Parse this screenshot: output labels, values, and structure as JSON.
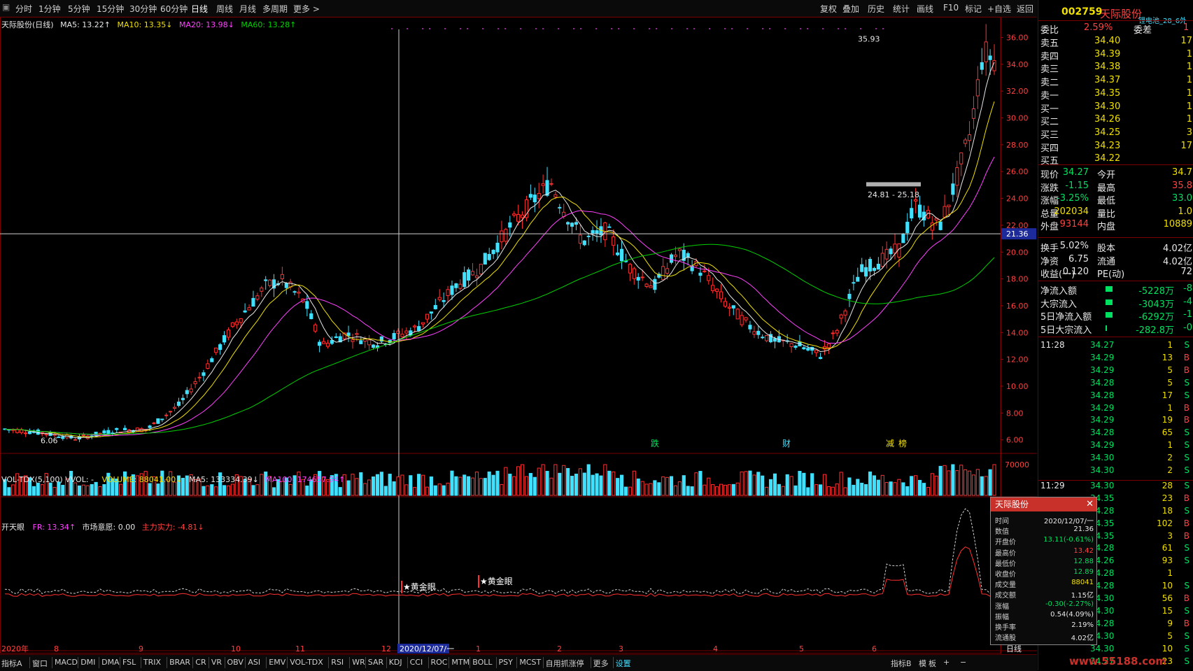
{
  "toolbar": {
    "left_items": [
      "分时",
      "1分钟",
      "5分钟",
      "15分钟",
      "30分钟",
      "60分钟",
      "日线",
      "周线",
      "月线",
      "多周期",
      "更多 >"
    ],
    "active": "日线",
    "right_items": [
      "复权",
      "叠加",
      "历史",
      "统计",
      "画线",
      "F10",
      "标记",
      "+自选",
      "返回"
    ]
  },
  "main_chart": {
    "title": "天际股份(日线)",
    "ma5": "MA5: 13.22↑",
    "ma10": "MA10: 13.35↓",
    "ma20": "MA20: 13.98↓",
    "ma60": "MA60: 13.28↑",
    "price_axis": [
      "36.00",
      "34.00",
      "32.00",
      "30.00",
      "28.00",
      "26.00",
      "24.00",
      "22.00",
      "20.00",
      "18.00",
      "16.00",
      "14.00",
      "12.00",
      "10.00",
      "8.00",
      "6.00"
    ],
    "crosshair_price": "21.36",
    "high_label": "35.93",
    "low_label": "6.06",
    "range_label": "24.81 - 25.18",
    "event_labels": [
      "跌",
      "财",
      "减",
      "榜"
    ]
  },
  "volume_chart": {
    "title": "VOL-TDX(5,100) VVOL: -",
    "volume": "VOLUME: 88041.00↓",
    "ma5": "MA5: 133334.39↓",
    "ma100": "MA100: 174657.94↑",
    "axis_top": "70000"
  },
  "ktj_chart": {
    "title": "开天眼",
    "fr": "FR: 13.34↑",
    "yy": "市场意愿: 0.00",
    "zl": "主力实力: -4.81↓",
    "signals": [
      "★黄金眼",
      "★黄金眼"
    ]
  },
  "date_axis": {
    "labels": [
      "2020年",
      "8",
      "9",
      "10",
      "11",
      "12",
      "1",
      "2",
      "3",
      "4",
      "5",
      "6"
    ],
    "cursor_date": "2020/12/07/一",
    "period": "日线"
  },
  "bottom_tabs": [
    "指标A",
    "窗口",
    "MACD",
    "DMI",
    "DMA",
    "FSL",
    "TRIX",
    "BRAR",
    "CR",
    "VR",
    "OBV",
    "ASI",
    "EMV",
    "VOL-TDX",
    "RSI",
    "WR",
    "SAR",
    "KDJ",
    "CCI",
    "ROC",
    "MTM",
    "BOLL",
    "PSY",
    "MCST",
    "自用抓涨停",
    "更多",
    "设置"
  ],
  "bottom_right": [
    "指标B",
    "模",
    "板",
    "+",
    "−"
  ],
  "stock": {
    "code": "002759",
    "name": "天际股份",
    "sector": "锂电池_28_6外",
    "weibi_label": "委比",
    "weibi": "2.59%",
    "weicha_label": "委差",
    "weicha": "1",
    "asks": [
      {
        "label": "卖五",
        "price": "34.40",
        "vol": "17"
      },
      {
        "label": "卖四",
        "price": "34.39",
        "vol": "1"
      },
      {
        "label": "卖三",
        "price": "34.38",
        "vol": "1"
      },
      {
        "label": "卖二",
        "price": "34.37",
        "vol": "1"
      },
      {
        "label": "卖一",
        "price": "34.35",
        "vol": "1"
      }
    ],
    "bids": [
      {
        "label": "买一",
        "price": "34.30",
        "vol": "1"
      },
      {
        "label": "买二",
        "price": "34.26",
        "vol": "1"
      },
      {
        "label": "买三",
        "price": "34.25",
        "vol": "3"
      },
      {
        "label": "买四",
        "price": "34.23",
        "vol": "17"
      },
      {
        "label": "买五",
        "price": "34.22",
        "vol": ""
      }
    ],
    "quote": [
      {
        "k1": "现价",
        "v1": "34.27",
        "k2": "今开",
        "v2": "34.7"
      },
      {
        "k1": "涨跌",
        "v1": "-1.15",
        "k2": "最高",
        "v2": "35.8"
      },
      {
        "k1": "涨幅",
        "v1": "-3.25%",
        "k2": "最低",
        "v2": "33.0"
      },
      {
        "k1": "总量",
        "v1": "202034",
        "k2": "量比",
        "v2": "1.0"
      },
      {
        "k1": "外盘",
        "v1": "93144",
        "k2": "内盘",
        "v2": "10889"
      }
    ],
    "fund": [
      {
        "k1": "换手",
        "v1": "5.02%",
        "k2": "股本",
        "v2": "4.02亿"
      },
      {
        "k1": "净资",
        "v1": "6.75",
        "k2": "流通",
        "v2": "4.02亿"
      },
      {
        "k1": "收益(一)",
        "v1": "0.120",
        "k2": "PE(动)",
        "v2": "72"
      }
    ],
    "flows": [
      {
        "k": "净流入额",
        "v": "-5228万",
        "v2": "-8"
      },
      {
        "k": "大宗流入",
        "v": "-3043万",
        "v2": "-4"
      },
      {
        "k": "5日净流入额",
        "v": "-6292万",
        "v2": "-1"
      },
      {
        "k": "5日大宗流入",
        "v": "-282.8万",
        "v2": "-0"
      }
    ],
    "ticks": [
      {
        "t": "11:28",
        "p": "34.27",
        "v": "1",
        "d": "S"
      },
      {
        "t": "",
        "p": "34.29",
        "v": "13",
        "d": "B"
      },
      {
        "t": "",
        "p": "34.29",
        "v": "5",
        "d": "B"
      },
      {
        "t": "",
        "p": "34.28",
        "v": "5",
        "d": "S"
      },
      {
        "t": "",
        "p": "34.28",
        "v": "17",
        "d": "S"
      },
      {
        "t": "",
        "p": "34.29",
        "v": "1",
        "d": "B"
      },
      {
        "t": "",
        "p": "34.29",
        "v": "19",
        "d": "B"
      },
      {
        "t": "",
        "p": "34.28",
        "v": "65",
        "d": "S"
      },
      {
        "t": "",
        "p": "34.29",
        "v": "1",
        "d": "S"
      },
      {
        "t": "",
        "p": "34.30",
        "v": "2",
        "d": "S"
      },
      {
        "t": "",
        "p": "34.30",
        "v": "2",
        "d": "S"
      },
      {
        "t": "11:29",
        "p": "34.30",
        "v": "28",
        "d": "S"
      },
      {
        "t": "",
        "p": "34.35",
        "v": "23",
        "d": "B"
      },
      {
        "t": "",
        "p": "34.28",
        "v": "18",
        "d": "S"
      },
      {
        "t": "",
        "p": "34.35",
        "v": "102",
        "d": "B"
      },
      {
        "t": "",
        "p": "34.35",
        "v": "3",
        "d": "B"
      },
      {
        "t": "",
        "p": "34.28",
        "v": "61",
        "d": "S"
      },
      {
        "t": "",
        "p": "34.26",
        "v": "93",
        "d": "S"
      },
      {
        "t": "",
        "p": "34.28",
        "v": "1",
        "d": ""
      },
      {
        "t": "",
        "p": "34.28",
        "v": "10",
        "d": "S"
      },
      {
        "t": "",
        "p": "34.30",
        "v": "56",
        "d": "B"
      },
      {
        "t": "",
        "p": "34.30",
        "v": "15",
        "d": "S"
      },
      {
        "t": "",
        "p": "34.28",
        "v": "9",
        "d": "B"
      },
      {
        "t": "",
        "p": "34.30",
        "v": "5",
        "d": "S"
      },
      {
        "t": "",
        "p": "34.30",
        "v": "10",
        "d": "S"
      },
      {
        "t": "",
        "p": "34.27",
        "v": "23",
        "d": "S"
      }
    ]
  },
  "popup": {
    "title": "天际股份",
    "rows": [
      {
        "k": "时间",
        "v": "2020/12/07/一",
        "c": "white"
      },
      {
        "k": "数值",
        "v": "21.36",
        "c": "white"
      },
      {
        "k": "开盘价",
        "v": "13.11(-0.61%)",
        "c": "green"
      },
      {
        "k": "最高价",
        "v": "13.42",
        "c": "red"
      },
      {
        "k": "最低价",
        "v": "12.88",
        "c": "green"
      },
      {
        "k": "收盘价",
        "v": "12.89",
        "c": "green"
      },
      {
        "k": "成交量",
        "v": "88041",
        "c": "yellow"
      },
      {
        "k": "成交额",
        "v": "1.15亿",
        "c": "white"
      },
      {
        "k": "涨幅",
        "v": "-0.30(-2.27%)",
        "c": "green"
      },
      {
        "k": "振幅",
        "v": "0.54(4.09%)",
        "c": "white"
      },
      {
        "k": "换手率",
        "v": "2.19%",
        "c": "white"
      },
      {
        "k": "流通股",
        "v": "4.02亿",
        "c": "white"
      }
    ]
  },
  "watermark": "www.55188.com",
  "colors": {
    "up": "#ff3030",
    "down": "#40e0ff",
    "ma5": "#e8e8e8",
    "ma10": "#f0e000",
    "ma20": "#ff40ff",
    "ma60": "#00d000"
  }
}
